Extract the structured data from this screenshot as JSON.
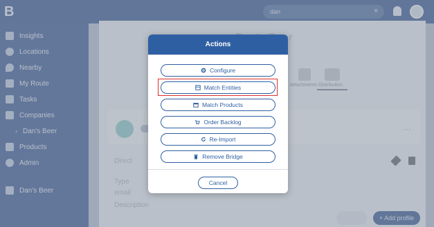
{
  "app": {
    "logo": "B"
  },
  "topbar": {
    "search_value": "dan",
    "search_clear": "×"
  },
  "sidebar": {
    "items": [
      {
        "label": "Insights",
        "icon": "trend-icon"
      },
      {
        "label": "Locations",
        "icon": "globe-icon"
      },
      {
        "label": "Nearby",
        "icon": "pin-icon"
      },
      {
        "label": "My Route",
        "icon": "route-icon"
      },
      {
        "label": "Tasks",
        "icon": "list-icon"
      },
      {
        "label": "Companies",
        "icon": "building-icon"
      },
      {
        "label": "Dan's Beer",
        "icon": "chevron-right-icon"
      },
      {
        "label": "Products",
        "icon": "product-icon"
      },
      {
        "label": "Admin",
        "icon": "gear-icon"
      }
    ],
    "footer_label": "Dan's Beer"
  },
  "background": {
    "page_title": "Dan's Beer",
    "tabs": [
      "Attachments",
      "Distribution"
    ],
    "card_dots": "···",
    "fields": [
      "Direct",
      "Type",
      "email",
      "Description"
    ],
    "add_profile": "+ Add profile"
  },
  "modal": {
    "title": "Actions",
    "actions": [
      {
        "label": "Configure",
        "icon": "gear-icon"
      },
      {
        "label": "Match Entities",
        "icon": "store-icon"
      },
      {
        "label": "Match Products",
        "icon": "calendar-icon"
      },
      {
        "label": "Order Backlog",
        "icon": "cart-icon"
      },
      {
        "label": "Re-Import",
        "icon": "refresh-icon"
      },
      {
        "label": "Remove Bridge",
        "icon": "trash-icon"
      }
    ],
    "cancel_label": "Cancel",
    "accent_color": "#2f5fa3",
    "highlight_color": "#d9302b"
  }
}
